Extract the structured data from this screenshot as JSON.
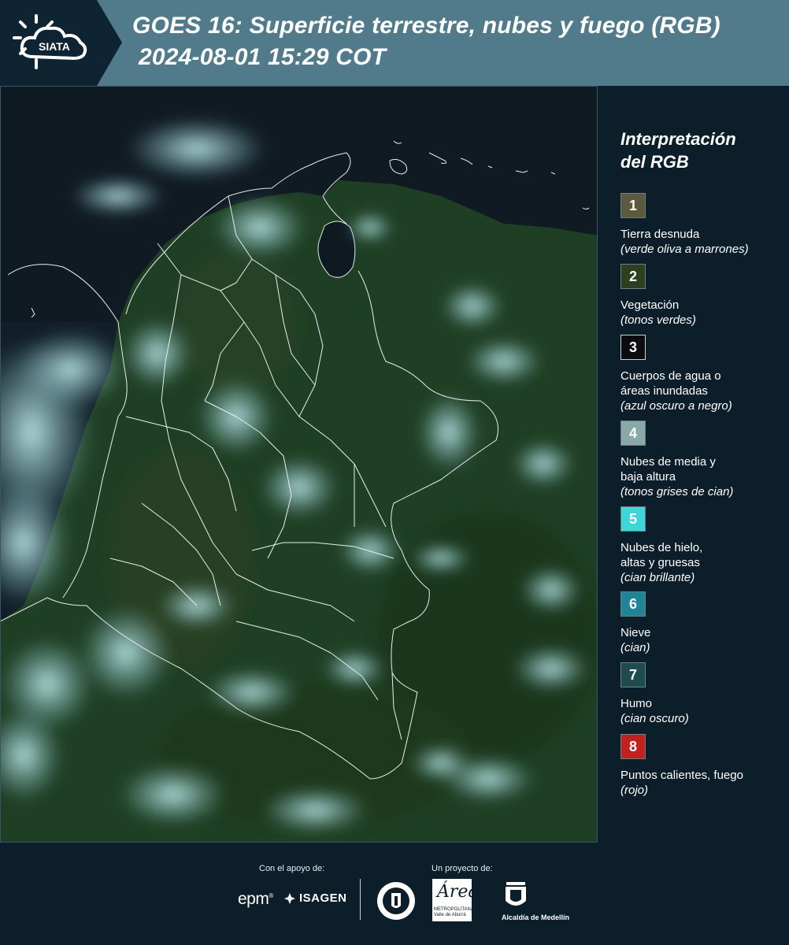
{
  "header": {
    "logo_text": "SIATA",
    "title_line1": "GOES 16: Superficie terrestre, nubes y fuego (RGB)",
    "title_line2": "2024-08-01 15:29 COT"
  },
  "legend": {
    "title_line1": "Interpretación",
    "title_line2": "del RGB",
    "items": [
      {
        "number": "1",
        "color": "#5b5a3e",
        "label_lines": [
          "Tierra desnuda"
        ],
        "sub": "(verde oliva a marrones)"
      },
      {
        "number": "2",
        "color": "#2e3f1e",
        "label_lines": [
          "Vegetación"
        ],
        "sub": "(tonos verdes)"
      },
      {
        "number": "3",
        "color": "#0b0c10",
        "label_lines": [
          "Cuerpos de agua o",
          "áreas inundadas"
        ],
        "sub": "(azul oscuro a negro)"
      },
      {
        "number": "4",
        "color": "#87aaa8",
        "label_lines": [
          "Nubes de media y",
          "baja altura"
        ],
        "sub": "(tonos grises de cian)"
      },
      {
        "number": "5",
        "color": "#3fd6d8",
        "label_lines": [
          "Nubes de hielo,",
          "altas y gruesas"
        ],
        "sub": "(cian brillante)"
      },
      {
        "number": "6",
        "color": "#1f8496",
        "label_lines": [
          "Nieve"
        ],
        "sub": "(cian)"
      },
      {
        "number": "7",
        "color": "#1d4b4e",
        "label_lines": [
          "Humo"
        ],
        "sub": "(cian oscuro)"
      },
      {
        "number": "8",
        "color": "#c2211e",
        "label_lines": [
          "Puntos calientes, fuego"
        ],
        "sub": "(rojo)"
      }
    ]
  },
  "footer": {
    "support_label": "Con el apoyo de:",
    "project_label": "Un proyecto de:",
    "epm": "epm",
    "isagen": "ISAGEN",
    "area_big": "Área",
    "area_small_1": "METROPOLITANA",
    "area_small_2": "Valle de Aburrá",
    "alcaldia": "Alcaldía de Medellín"
  },
  "colors": {
    "header_bg": "#517b8b",
    "logo_bg": "#0f2433",
    "page_bg": "#0d1e2b"
  }
}
